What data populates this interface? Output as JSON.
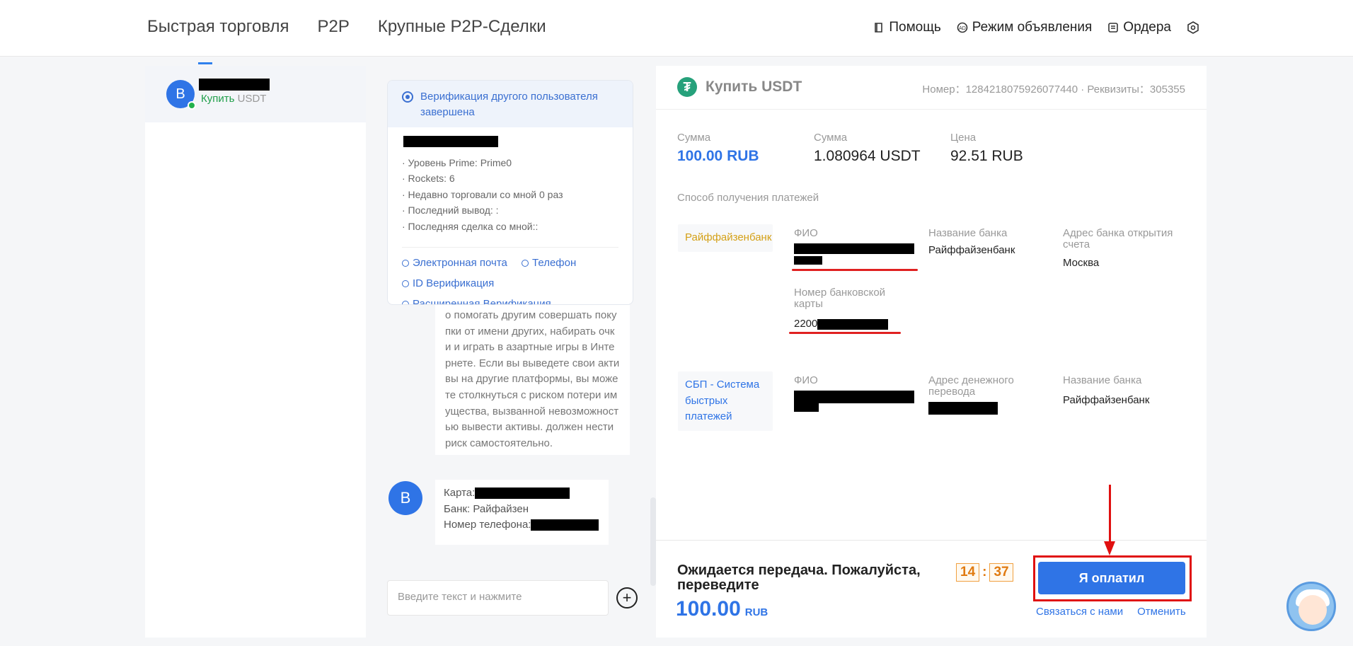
{
  "nav": {
    "items": [
      "Быстрая торговля",
      "P2P",
      "Крупные P2P-Сделки"
    ],
    "right": {
      "help": "Помощь",
      "ad_mode": "Режим объявления",
      "orders": "Ордера"
    }
  },
  "left": {
    "avatar_letter": "B",
    "action": "Купить",
    "asset": "USDT"
  },
  "chat": {
    "verify_title": "Верификация другого пользователя завершена",
    "info_lines": [
      "· Уровень Prime: Prime0",
      "· Rockets: 6",
      "· Недавно торговали со мной 0 раз",
      "· Последний вывод: :",
      "· Последняя сделка со мной::"
    ],
    "links": {
      "email": "Электронная почта",
      "phone": "Телефон",
      "id": "ID Верификация",
      "advanced": "Расширенная Верификация"
    },
    "warning": "о помогать другим совершать покупки от имени других, набирать очки и играть в азартные игры в Интернете. Если вы выведете свои активы на другие платформы, вы можете столкнуться с риском потери имущества, вызванной невозможностью вывести активы. должен нести риск самостоятельно.",
    "msg_avatar": "B",
    "msg_card": "Карта:",
    "msg_bank": "Банк: Райфайзен",
    "msg_phone": "Номер телефона:",
    "input_placeholder": "Введите текст и нажмите",
    "plus": "+"
  },
  "order": {
    "title": "Купить USDT",
    "meta": "Номер：1284218075926077440 · Реквизиты：305355",
    "sum_label_1": "Сумма",
    "sum_value_1": "100.00 RUB",
    "sum_label_2": "Сумма",
    "sum_value_2": "1.080964 USDT",
    "price_label": "Цена",
    "price_value": "92.51 RUB",
    "pay_methods_title": "Способ получения платежей",
    "method1": {
      "tag": "Райффайзенбанк",
      "tag_color": "#d4a017",
      "fio_label": "ФИО",
      "bank_label": "Название банка",
      "bank_value": "Райффайзенбанк",
      "address_label": "Адрес банка открытия счета",
      "address_value": "Москва",
      "card_label": "Номер банковской карты",
      "card_value": "2200"
    },
    "method2": {
      "tag": "СБП - Система быстрых платежей",
      "tag_color": "#2f74e6",
      "fio_label": "ФИО",
      "transfer_label": "Адрес денежного перевода",
      "bank_label": "Название банка",
      "bank_value": "Райффайзенбанк"
    },
    "footer": {
      "waiting": "Ожидается передача. Пожалуйста, переведите",
      "timer_min": "14",
      "timer_sep": ":",
      "timer_sec": "37",
      "amount": "100.00",
      "currency": "RUB",
      "pay_button": "Я оплатил",
      "contact": "Связаться с нами",
      "cancel": "Отменить"
    }
  }
}
